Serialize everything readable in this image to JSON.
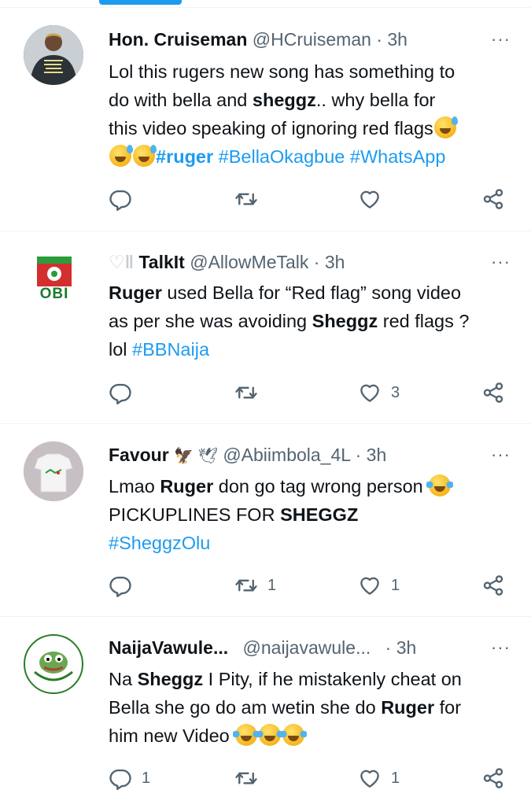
{
  "tweets": [
    {
      "name": "Hon. Cruiseman",
      "handle": "@HCruiseman",
      "sep": "·",
      "time": "3h",
      "more": "···",
      "body": [
        [
          {
            "t": "Lol this rugers new song has something to"
          }
        ],
        [
          {
            "t": "do with bella and "
          },
          {
            "t": "sheggz",
            "b": true
          },
          {
            "t": ".. why bella for"
          }
        ],
        [
          {
            "t": "this video speaking of ignoring red flags"
          },
          {
            "e": "sweat"
          }
        ],
        [
          {
            "e": "sweat"
          },
          {
            "e": "sweat"
          },
          {
            "t": "#ruger",
            "tag": true,
            "b": true
          },
          {
            "t": " "
          },
          {
            "t": "#BellaOkagbue",
            "tag": true
          },
          {
            "t": " "
          },
          {
            "t": "#WhatsApp",
            "tag": true
          }
        ]
      ],
      "replies": "",
      "retweets": "",
      "likes": ""
    },
    {
      "name_prefix": "♡‖",
      "name": "TalkIt",
      "handle": "@AllowMeTalk",
      "sep": "·",
      "time": "3h",
      "more": "···",
      "avatar_text": "OBI",
      "body": [
        [
          {
            "t": "Ruger",
            "b": true
          },
          {
            "t": " used Bella for “Red flag” song video"
          }
        ],
        [
          {
            "t": "as per she was avoiding "
          },
          {
            "t": "Sheggz",
            "b": true
          },
          {
            "t": " red flags ?"
          }
        ],
        [
          {
            "t": "lol "
          },
          {
            "t": "#BBNaija",
            "tag": true
          }
        ]
      ],
      "replies": "",
      "retweets": "",
      "likes": "3"
    },
    {
      "name": "Favour",
      "name_suffix": "🦅 🕊",
      "handle": "@Abiimbola_4L",
      "sep": "·",
      "time": "3h",
      "more": "···",
      "body": [
        [
          {
            "t": "Lmao "
          },
          {
            "t": "Ruger",
            "b": true
          },
          {
            "t": " don go tag wrong person "
          },
          {
            "e": "tears"
          }
        ],
        [
          {
            "t": "PICKUPLINES FOR "
          },
          {
            "t": "SHEGGZ",
            "b": true
          }
        ],
        [
          {
            "t": "#SheggzOlu",
            "tag": true
          }
        ]
      ],
      "replies": "",
      "retweets": "1",
      "likes": "1"
    },
    {
      "name": "NaijaVawule...",
      "handle": "@naijavawule...",
      "sep": "·",
      "time": "3h",
      "more": "···",
      "body": [
        [
          {
            "t": "Na "
          },
          {
            "t": "Sheggz",
            "b": true
          },
          {
            "t": " I Pity, if he mistakenly cheat on"
          }
        ],
        [
          {
            "t": "Bella she go do am wetin she do "
          },
          {
            "t": "Ruger",
            "b": true
          },
          {
            "t": " for"
          }
        ],
        [
          {
            "t": "him new Video "
          },
          {
            "e": "tears"
          },
          {
            "e": "tears"
          },
          {
            "e": "tears"
          }
        ]
      ],
      "replies": "1",
      "retweets": "",
      "likes": "1"
    }
  ],
  "colors": {
    "accent": "#1d9bf0",
    "secondary_text": "#536471",
    "divider": "#eff3f4"
  },
  "icons": {
    "reply": "reply-icon",
    "retweet": "retweet-icon",
    "like": "heart-icon",
    "share": "share-icon",
    "more": "more-icon"
  }
}
